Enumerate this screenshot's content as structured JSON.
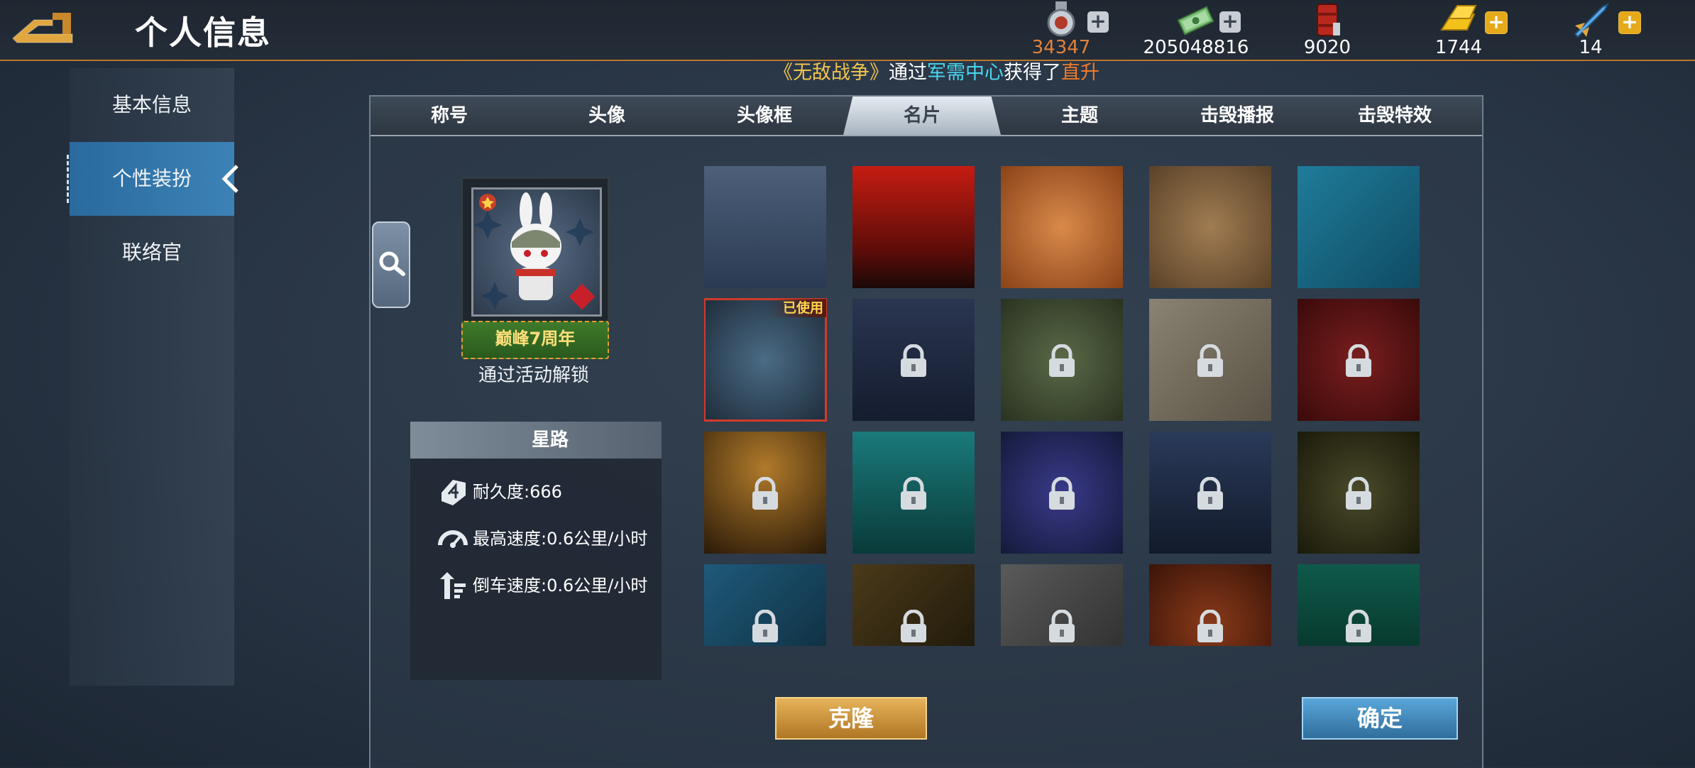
{
  "header": {
    "title": "个人信息",
    "resources": [
      {
        "icon": "medal-icon",
        "value": "34347",
        "color": "#e0823a",
        "plus": true
      },
      {
        "icon": "cash-icon",
        "value": "205048816",
        "color": "#ffffff",
        "plus": true
      },
      {
        "icon": "fuel-barrel-icon",
        "value": "9020",
        "color": "#ffffff",
        "plus": false
      },
      {
        "icon": "gold-bar-icon",
        "value": "1744",
        "color": "#ffffff",
        "plus": true
      },
      {
        "icon": "rocket-icon",
        "value": "14",
        "color": "#ffffff",
        "plus": true
      }
    ]
  },
  "ticker": {
    "p1": "《无敌战争》",
    "p2": "通过",
    "p3": "军需中心",
    "p4": "获得了",
    "p5": "直升机"
  },
  "sidebar": {
    "items": [
      {
        "label": "基本信息",
        "active": false
      },
      {
        "label": "个性装扮",
        "active": true
      },
      {
        "label": "联络官",
        "active": false
      }
    ]
  },
  "tabs": [
    {
      "label": "称号",
      "active": false
    },
    {
      "label": "头像",
      "active": false
    },
    {
      "label": "头像框",
      "active": false
    },
    {
      "label": "名片",
      "active": true
    },
    {
      "label": "主题",
      "active": false
    },
    {
      "label": "击毁播报",
      "active": false
    },
    {
      "label": "击毁特效",
      "active": false
    }
  ],
  "preview": {
    "anniversary_banner": "巅峰7周年",
    "unlock_text": "通过活动解锁",
    "name": "星路",
    "stats": [
      {
        "icon": "armor-shield-icon",
        "label": "耐久度:666"
      },
      {
        "icon": "speedometer-icon",
        "label": "最高速度:0.6公里/小时"
      },
      {
        "icon": "reverse-arrow-icon",
        "label": "倒车速度:0.6公里/小时"
      }
    ]
  },
  "cards": {
    "used_badge": "已使用",
    "tiles": [
      {
        "theme": "hex-pattern",
        "locked": false,
        "used": false,
        "bg": "linear-gradient(180deg,#4d6079,#2a3a52)"
      },
      {
        "theme": "star-flag",
        "locked": false,
        "used": false,
        "bg": "linear-gradient(180deg,#c51c12,#5b0c08 70%,#1a0a08)"
      },
      {
        "theme": "autumn-leaves",
        "locked": false,
        "used": false,
        "bg": "radial-gradient(circle,#d98a4a,#8a4218)"
      },
      {
        "theme": "paisley",
        "locked": false,
        "used": false,
        "bg": "radial-gradient(circle,#a07c52,#5a4228)"
      },
      {
        "theme": "teal-waves",
        "locked": false,
        "used": false,
        "bg": "linear-gradient(135deg,#1f7c9a,#0f4b63)"
      },
      {
        "theme": "shuriken",
        "locked": false,
        "used": true,
        "bg": "radial-gradient(circle,#4a6b85,#1e2c3a)"
      },
      {
        "theme": "navy-star",
        "locked": true,
        "used": false,
        "bg": "linear-gradient(180deg,#2a3550,#141c2e)"
      },
      {
        "theme": "digital-camo",
        "locked": true,
        "used": false,
        "bg": "radial-gradient(circle,#5a6a48,#2a3220)"
      },
      {
        "theme": "beige-diamond",
        "locked": true,
        "used": false,
        "bg": "linear-gradient(135deg,#8a8272,#5a5244)"
      },
      {
        "theme": "crimson",
        "locked": true,
        "used": false,
        "bg": "radial-gradient(circle,#7a1e1e,#3a0a0a)"
      },
      {
        "theme": "golden-glow",
        "locked": true,
        "used": false,
        "bg": "radial-gradient(circle at 50% 30%,#b07a2a,#2a1a08)"
      },
      {
        "theme": "ocean",
        "locked": true,
        "used": false,
        "bg": "linear-gradient(180deg,#1a7a7a,#0a3a3a)"
      },
      {
        "theme": "night-sky",
        "locked": true,
        "used": false,
        "bg": "radial-gradient(circle,#3a3a8a,#141a3a)"
      },
      {
        "theme": "helicopter",
        "locked": true,
        "used": false,
        "bg": "linear-gradient(180deg,#2a3a5a,#121a2a)"
      },
      {
        "theme": "floral",
        "locked": true,
        "used": false,
        "bg": "radial-gradient(circle,#4a4a2a,#1a1a0a)"
      },
      {
        "theme": "frost",
        "locked": true,
        "used": false,
        "bg": "linear-gradient(135deg,#1e5a7a,#0e2a3a)"
      },
      {
        "theme": "dark-stars",
        "locked": true,
        "used": false,
        "bg": "linear-gradient(135deg,#4a3a1a,#1a1408)"
      },
      {
        "theme": "steel-stripe",
        "locked": true,
        "used": false,
        "bg": "linear-gradient(135deg,#5a5a5a,#2a2a2a)"
      },
      {
        "theme": "tribal-swirl",
        "locked": true,
        "used": false,
        "bg": "radial-gradient(circle,#8a3a1a,#3a1408)"
      },
      {
        "theme": "emerald-trees",
        "locked": true,
        "used": false,
        "bg": "linear-gradient(180deg,#0e5a4a,#062a22)"
      }
    ]
  },
  "buttons": {
    "clone": "克隆",
    "confirm": "确定"
  }
}
